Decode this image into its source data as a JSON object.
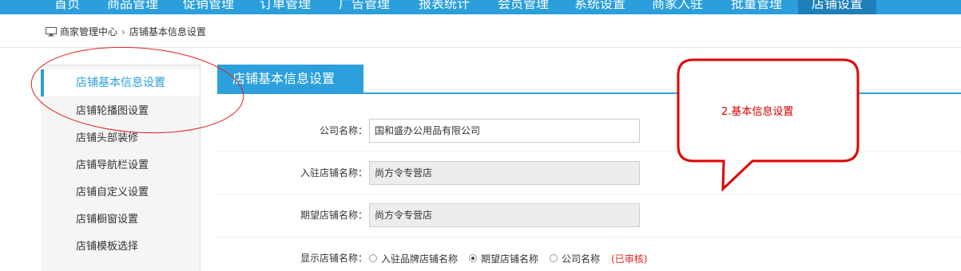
{
  "nav": {
    "items": [
      {
        "label": "首页"
      },
      {
        "label": "商品管理"
      },
      {
        "label": "促销管理"
      },
      {
        "label": "订单管理"
      },
      {
        "label": "广告管理"
      },
      {
        "label": "报表统计"
      },
      {
        "label": "会员管理"
      },
      {
        "label": "系统设置"
      },
      {
        "label": "商家入驻"
      },
      {
        "label": "批量管理"
      },
      {
        "label": "店铺设置"
      }
    ],
    "active_index": 10
  },
  "breadcrumb": {
    "home": "商家管理中心",
    "separator": "›",
    "current": "店铺基本信息设置"
  },
  "sidebar": {
    "items": [
      {
        "label": "店铺基本信息设置"
      },
      {
        "label": "店铺轮播图设置"
      },
      {
        "label": "店铺头部装修"
      },
      {
        "label": "店铺导航栏设置"
      },
      {
        "label": "店铺自定义设置"
      },
      {
        "label": "店铺橱窗设置"
      },
      {
        "label": "店铺模板选择"
      }
    ],
    "active_index": 0
  },
  "section": {
    "title": "店铺基本信息设置"
  },
  "form": {
    "company_name": {
      "label": "公司名称：",
      "value": "国和盛办公用品有限公司"
    },
    "settled_name": {
      "label": "入驻店铺名称：",
      "value": "尚方令专营店"
    },
    "expected_name": {
      "label": "期望店铺名称：",
      "value": "尚方令专营店"
    },
    "display_name": {
      "label": "显示店铺名称：",
      "options": [
        "入驻品牌店铺名称",
        "期望店铺名称",
        "公司名称"
      ],
      "selected_index": 1,
      "status": "(已审核)"
    }
  },
  "annotation": {
    "callout_text": "2.基本信息设置"
  },
  "colors": {
    "nav_bg": "#2b9fdc",
    "nav_active_bg": "#1e7fb8",
    "accent": "#2ba0dd",
    "annotation_red": "#e00000"
  }
}
